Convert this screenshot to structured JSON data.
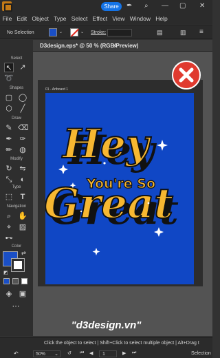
{
  "menu": {
    "share": "Share",
    "items": [
      "File",
      "Edit",
      "Object",
      "Type",
      "Select",
      "Effect",
      "View",
      "Window",
      "Help"
    ]
  },
  "control_bar": {
    "selection": "No Selection",
    "stroke_label": "Stroke:"
  },
  "toolbar": {
    "sections": [
      "Select",
      "Shapes",
      "Draw",
      "Modify",
      "Type",
      "Navigation",
      "Color"
    ]
  },
  "document": {
    "tab_title": "D3design.eps* @ 50 % (RGB/Preview)",
    "artboard_label": "01 - Artboard 1"
  },
  "artwork": {
    "line1": "Hey",
    "line2": "You're So",
    "line3": "Great",
    "background_color": "#1047c5",
    "text_color": "#f7b731",
    "shadow_color": "#111111"
  },
  "watermark": "\"d3design.vn\"",
  "status": {
    "hint": "Click the object to select | Shift+Click to select multiple object | Alt+Drag t",
    "zoom": "50%",
    "page": "1",
    "mode": "Selection"
  }
}
